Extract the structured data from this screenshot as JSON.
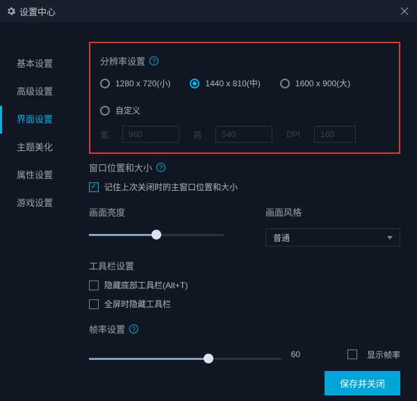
{
  "titlebar": {
    "title": "设置中心"
  },
  "sidebar": {
    "items": [
      {
        "label": "基本设置"
      },
      {
        "label": "高级设置"
      },
      {
        "label": "界面设置"
      },
      {
        "label": "主题美化"
      },
      {
        "label": "属性设置"
      },
      {
        "label": "游戏设置"
      }
    ]
  },
  "res": {
    "title": "分辨率设置",
    "opts": [
      {
        "label": "1280 x 720(小)"
      },
      {
        "label": "1440 x 810(中)"
      },
      {
        "label": "1600 x 900(大)"
      },
      {
        "label": "自定义"
      }
    ],
    "wl": "宽",
    "wv": "960",
    "hl": "高",
    "hv": "540",
    "dl": "DPI",
    "dv": "180"
  },
  "winpos": {
    "title": "窗口位置和大小",
    "cb": "记住上次关闭时的主窗口位置和大小"
  },
  "bright": {
    "title": "画面亮度"
  },
  "style": {
    "title": "画面风格",
    "sel": "普通"
  },
  "toolbar": {
    "title": "工具栏设置",
    "cb1": "隐藏底部工具栏(Alt+T)",
    "cb2": "全屏时隐藏工具栏"
  },
  "fps": {
    "title": "帧率设置",
    "val": "60",
    "cb": "显示帧率"
  },
  "footer": {
    "save": "保存并关闭"
  }
}
